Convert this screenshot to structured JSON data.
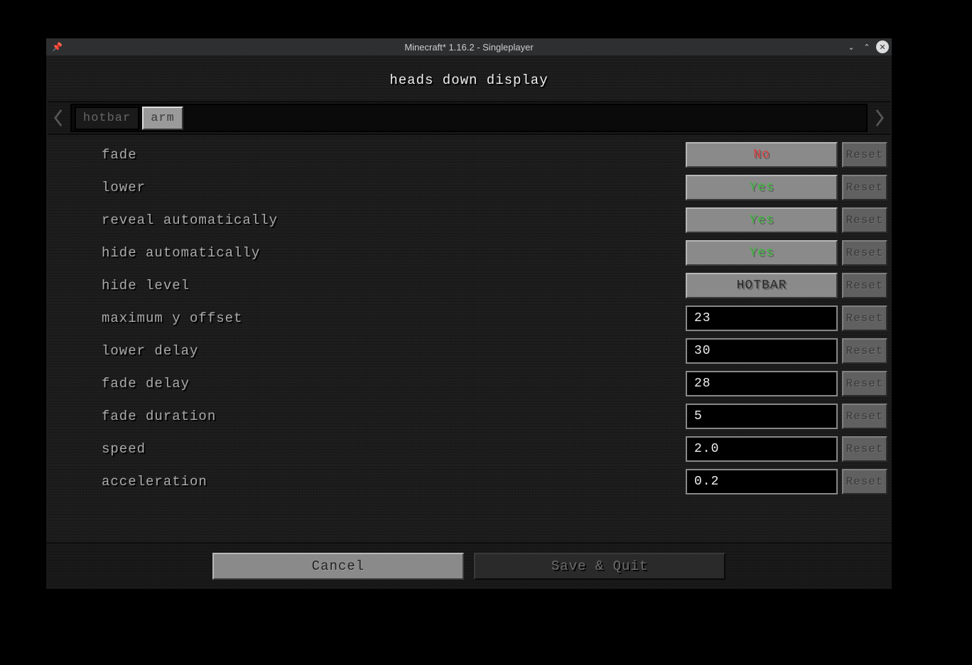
{
  "window": {
    "title": "Minecraft* 1.16.2 - Singleplayer"
  },
  "page": {
    "title": "heads down display"
  },
  "tabs": {
    "items": [
      {
        "label": "hotbar",
        "active": false
      },
      {
        "label": "arm",
        "active": true
      }
    ]
  },
  "settings": [
    {
      "label": "fade",
      "type": "toggle",
      "value": "No",
      "class": "val-no",
      "reset": "Reset"
    },
    {
      "label": "lower",
      "type": "toggle",
      "value": "Yes",
      "class": "val-yes",
      "reset": "Reset"
    },
    {
      "label": "reveal automatically",
      "type": "toggle",
      "value": "Yes",
      "class": "val-yes",
      "reset": "Reset"
    },
    {
      "label": "hide automatically",
      "type": "toggle",
      "value": "Yes",
      "class": "val-yes",
      "reset": "Reset"
    },
    {
      "label": "hide level",
      "type": "toggle",
      "value": "HOTBAR",
      "class": "val-plain",
      "reset": "Reset"
    },
    {
      "label": "maximum y offset",
      "type": "input",
      "value": "23",
      "reset": "Reset"
    },
    {
      "label": "lower delay",
      "type": "input",
      "value": "30",
      "reset": "Reset"
    },
    {
      "label": "fade delay",
      "type": "input",
      "value": "28",
      "reset": "Reset"
    },
    {
      "label": "fade duration",
      "type": "input",
      "value": "5",
      "reset": "Reset"
    },
    {
      "label": "speed",
      "type": "input",
      "value": "2.0",
      "reset": "Reset"
    },
    {
      "label": "acceleration",
      "type": "input",
      "value": "0.2",
      "reset": "Reset"
    }
  ],
  "footer": {
    "cancel": "Cancel",
    "save": "Save & Quit"
  }
}
